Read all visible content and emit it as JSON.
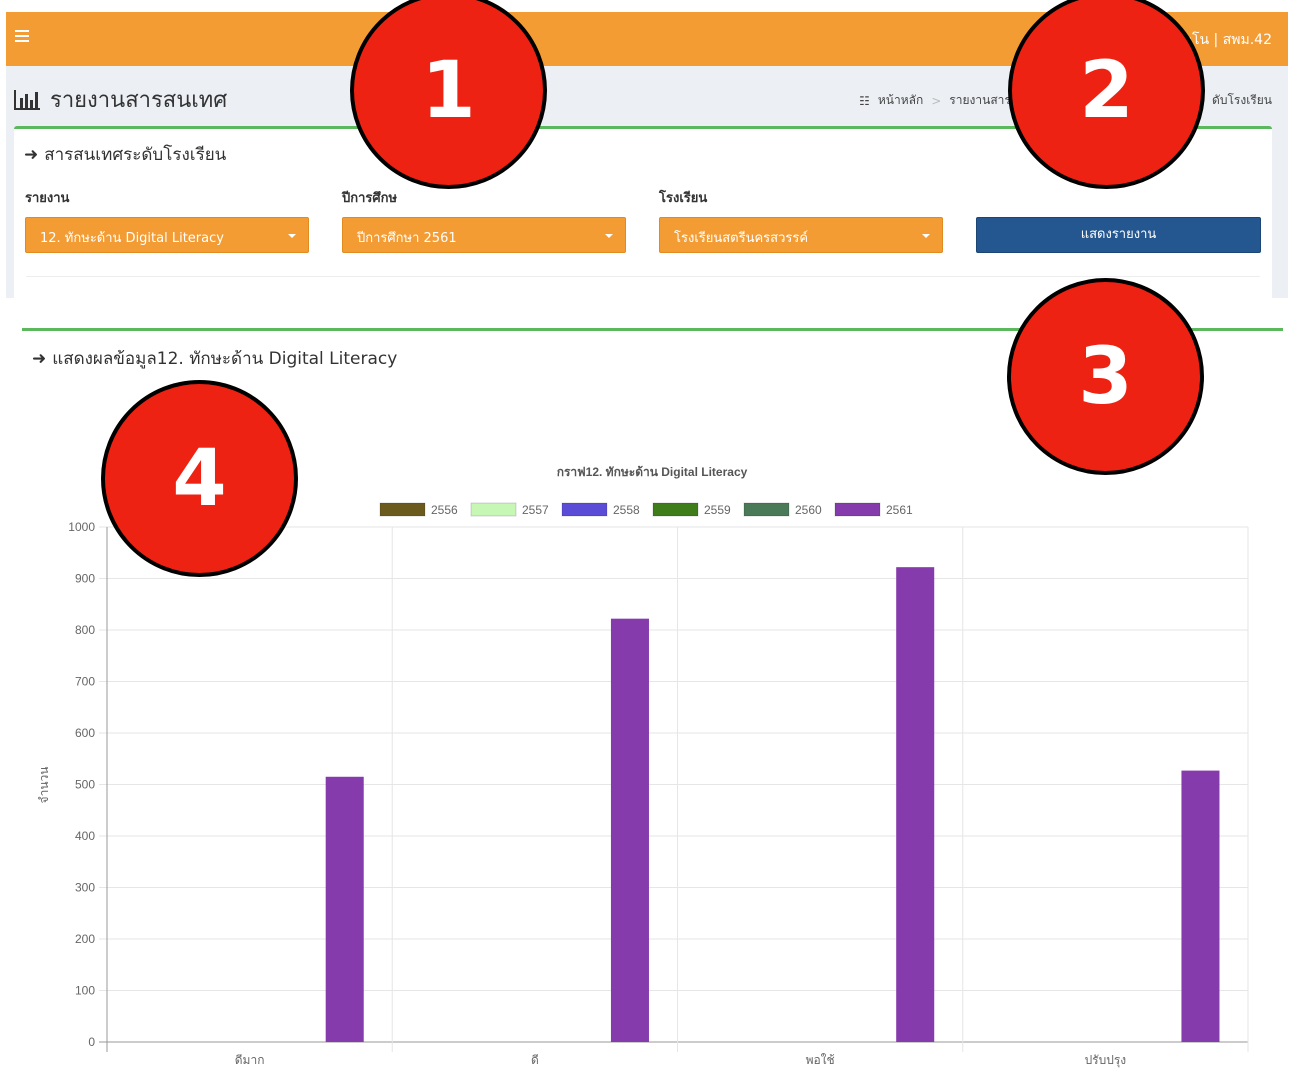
{
  "header": {
    "user_text": "ะโน | สพม.42"
  },
  "page": {
    "title": "รายงานสารสนเทศ"
  },
  "breadcrumb": {
    "home": "หน้าหลัก",
    "reports": "รายงานสารสนเทศ",
    "current": "ดับโรงเรียน"
  },
  "filter_box": {
    "title": "สารสนเทศระดับโรงเรียน",
    "report_label": "รายงาน",
    "report_value": "12. ทักษะด้าน Digital Literacy",
    "year_label": "ปีการศึกษ",
    "year_value": "ปีการศึกษา 2561",
    "school_label": "โรงเรียน",
    "school_value": "โรงเรียนสตรีนครสวรรค์",
    "show_button": "แสดงรายงาน"
  },
  "result_box": {
    "title": "แสดงผลข้อมูล12. ทักษะด้าน Digital Literacy"
  },
  "annotations": [
    "1",
    "2",
    "3",
    "4"
  ],
  "colors": {
    "header": "#f39c34",
    "button": "#24578f",
    "box_border": "#5cb85c",
    "annotation": "#ee2212"
  },
  "chart_data": {
    "type": "bar",
    "title": "กราฟ12. ทักษะด้าน Digital Literacy",
    "ylabel": "จำนวน",
    "xlabel": "",
    "categories": [
      "ดีมาก",
      "ดี",
      "พอใช้",
      "ปรับปรุง"
    ],
    "ylim": [
      0,
      1000
    ],
    "yticks": [
      0,
      100,
      200,
      300,
      400,
      500,
      600,
      700,
      800,
      900,
      1000
    ],
    "legend_position": "top",
    "grid": true,
    "series": [
      {
        "name": "2556",
        "color": "#6b5a1e",
        "values": [
          0,
          0,
          0,
          0
        ]
      },
      {
        "name": "2557",
        "color": "#c6f7b4",
        "values": [
          0,
          0,
          0,
          0
        ]
      },
      {
        "name": "2558",
        "color": "#5a4cd6",
        "values": [
          0,
          0,
          0,
          0
        ]
      },
      {
        "name": "2559",
        "color": "#3f7c1a",
        "values": [
          0,
          0,
          0,
          0
        ]
      },
      {
        "name": "2560",
        "color": "#4a7a58",
        "values": [
          0,
          0,
          0,
          0
        ]
      },
      {
        "name": "2561",
        "color": "#863bad",
        "values": [
          515,
          822,
          922,
          527
        ]
      }
    ]
  }
}
